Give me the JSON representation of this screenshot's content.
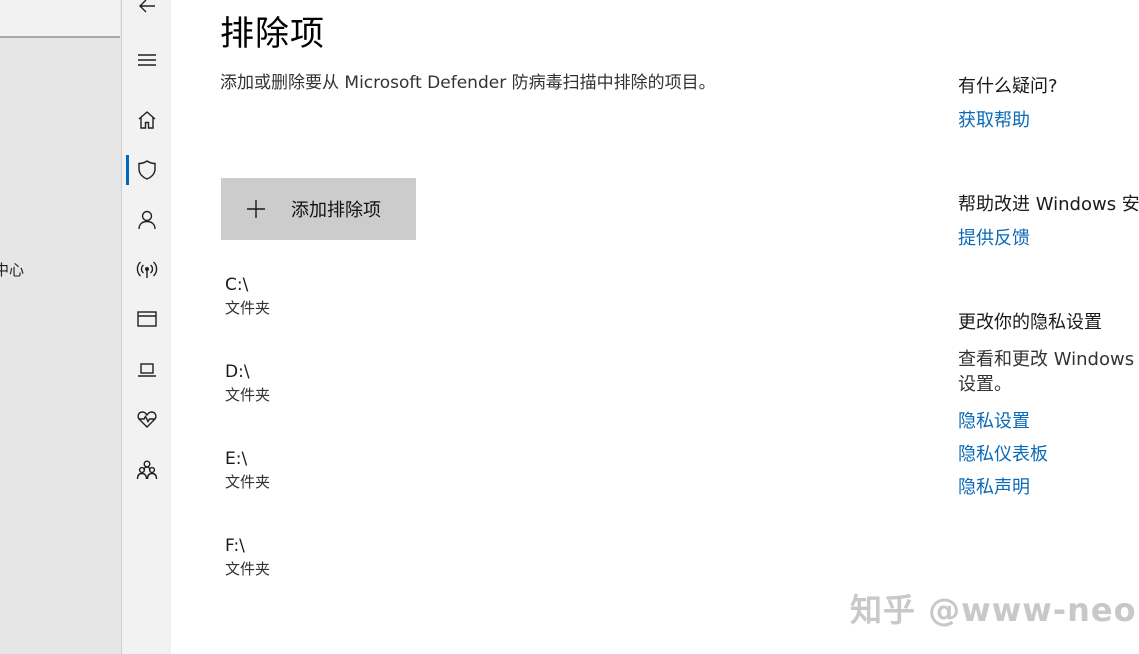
{
  "background_window": {
    "partial_text": "中心"
  },
  "rail": {
    "items": [
      "back-arrow-icon",
      "hamburger-menu-icon",
      "home-icon",
      "shield-icon",
      "person-icon",
      "wireless-icon",
      "app-browser-icon",
      "laptop-icon",
      "heart-health-icon",
      "family-icon"
    ]
  },
  "main": {
    "title": "排除项",
    "description": "添加或删除要从 Microsoft Defender 防病毒扫描中排除的项目。",
    "add_button_label": "添加排除项",
    "exclusions": [
      {
        "path": "C:\\",
        "type": "文件夹"
      },
      {
        "path": "D:\\",
        "type": "文件夹"
      },
      {
        "path": "E:\\",
        "type": "文件夹"
      },
      {
        "path": "F:\\",
        "type": "文件夹"
      }
    ]
  },
  "sidebar": {
    "question_heading": "有什么疑问?",
    "get_help_link": "获取帮助",
    "improve_heading": "帮助改进 Windows 安",
    "feedback_link": "提供反馈",
    "privacy_heading": "更改你的隐私设置",
    "privacy_desc": "查看和更改 Windows 设置。",
    "privacy_links": [
      "隐私设置",
      "隐私仪表板",
      "隐私声明"
    ]
  },
  "watermark": "知乎 @www-neo",
  "colors": {
    "accent": "#0067c0",
    "link": "#0a6ab8",
    "button": "#cccccc",
    "rail": "#f2f2f2"
  }
}
